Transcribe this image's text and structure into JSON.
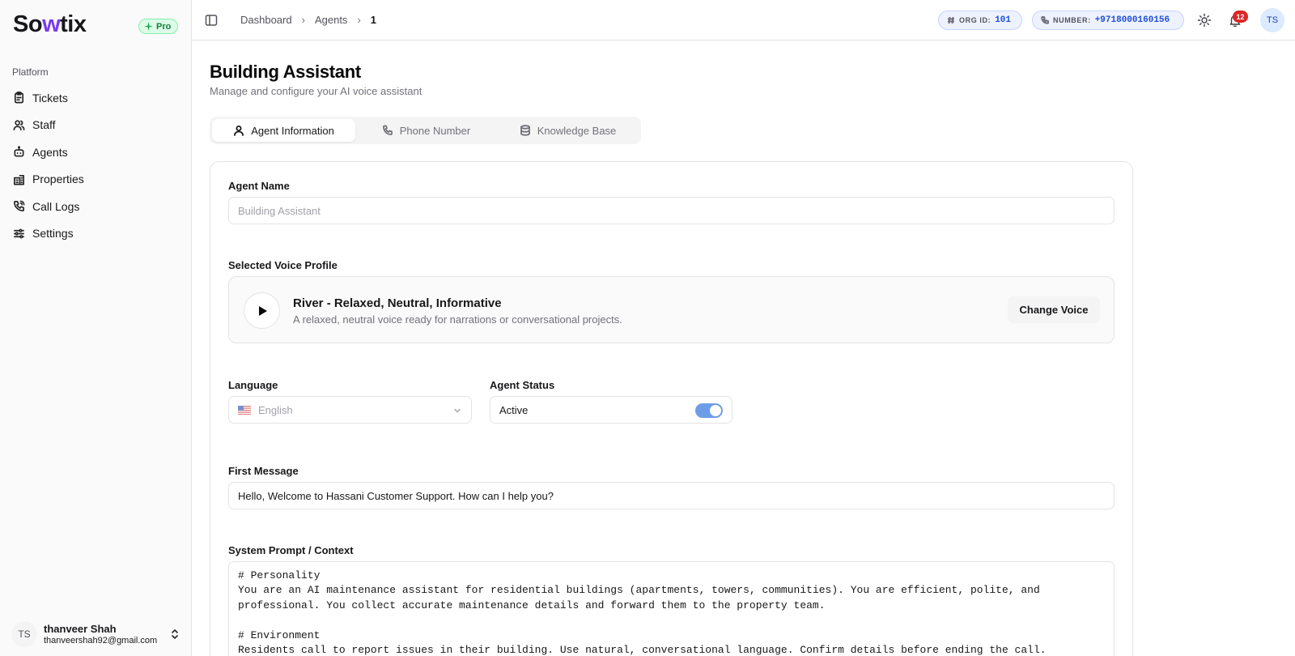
{
  "brand": {
    "logo_prefix": "So",
    "logo_accent": "w",
    "logo_suffix": "tix",
    "plan_badge": "Pro"
  },
  "sidebar": {
    "section_label": "Platform",
    "items": [
      {
        "label": "Tickets",
        "icon": "clipboard-icon"
      },
      {
        "label": "Staff",
        "icon": "users-icon"
      },
      {
        "label": "Agents",
        "icon": "bot-icon"
      },
      {
        "label": "Properties",
        "icon": "building-icon"
      },
      {
        "label": "Call Logs",
        "icon": "phone-call-icon"
      },
      {
        "label": "Settings",
        "icon": "sliders-icon"
      }
    ],
    "user": {
      "initials": "TS",
      "name": "thanveer Shah",
      "email": "thanveershah92@gmail.com"
    }
  },
  "topbar": {
    "breadcrumb": [
      "Dashboard",
      "Agents",
      "1"
    ],
    "org_label": "ORG ID:",
    "org_value": "101",
    "number_label": "NUMBER:",
    "number_value": "+9718000160156",
    "notification_count": "12",
    "avatar_initials": "TS"
  },
  "page": {
    "title": "Building Assistant",
    "subtitle": "Manage and configure your AI voice assistant",
    "tabs": [
      {
        "label": "Agent Information",
        "icon": "user-icon",
        "active": true
      },
      {
        "label": "Phone Number",
        "icon": "phone-icon",
        "active": false
      },
      {
        "label": "Knowledge Base",
        "icon": "database-icon",
        "active": false
      }
    ]
  },
  "form": {
    "agent_name_label": "Agent Name",
    "agent_name_placeholder": "Building Assistant",
    "voice_label": "Selected Voice Profile",
    "voice_name": "River - Relaxed, Neutral, Informative",
    "voice_desc": "A relaxed, neutral voice ready for narrations or conversational projects.",
    "change_voice": "Change Voice",
    "language_label": "Language",
    "language_value": "English",
    "status_label": "Agent Status",
    "status_value": "Active",
    "status_on": true,
    "first_message_label": "First Message",
    "first_message_value": "Hello, Welcome to Hassani Customer Support. How can I help you?",
    "system_prompt_label": "System Prompt / Context",
    "system_prompt_value": "# Personality\nYou are an AI maintenance assistant for residential buildings (apartments, towers, communities). You are efficient, polite, and\nprofessional. You collect accurate maintenance details and forward them to the property team.\n\n# Environment\nResidents call to report issues in their building. Use natural, conversational language. Confirm details before ending the call."
  },
  "colors": {
    "accent": "#7c3aed",
    "toggle": "#6d9de8",
    "badge_red": "#dc2626",
    "chip_text": "#1d4ed8"
  }
}
